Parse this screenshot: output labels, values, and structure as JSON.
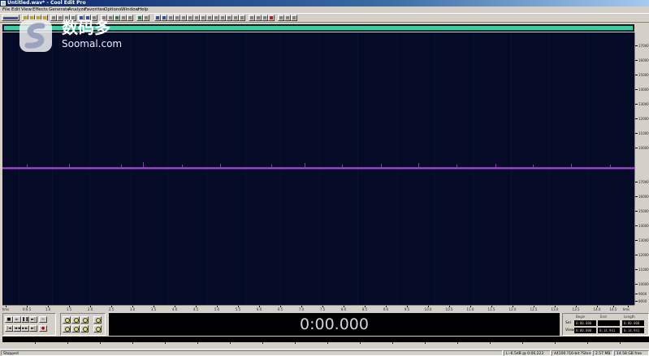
{
  "window": {
    "title": "Untitled.wav* - Cool Edit Pro"
  },
  "menu": [
    "File",
    "Edit",
    "View",
    "Effects",
    "Generate",
    "Analyze",
    "Favorites",
    "Options",
    "Window",
    "Help"
  ],
  "vruler_labels": [
    "17000",
    "16000",
    "15000",
    "14000",
    "13000",
    "12000",
    "11000",
    "10000",
    "17000",
    "16000",
    "15000",
    "14000",
    "13000",
    "12000",
    "11000",
    "10000",
    "9000",
    "8000"
  ],
  "hruler_labels": [
    "hms",
    "0:0.5",
    "1.0",
    "1.5",
    "2.0",
    "2.5",
    "3.0",
    "3.5",
    "4.0",
    "4.5",
    "5.0",
    "5.5",
    "6.0",
    "6.5",
    "7.0",
    "7.5",
    "8.0",
    "8.5",
    "9.0",
    "9.5",
    "10.0",
    "10.5",
    "11.0",
    "11.5",
    "12.0",
    "12.5",
    "13.0",
    "13.5",
    "14.0",
    "14.5",
    "hms"
  ],
  "time_display": "0:00.000",
  "selection": {
    "headers": [
      "Begin",
      "End",
      "Length"
    ],
    "sel_label": "Sel",
    "view_label": "View",
    "sel_values": [
      "0:00.000",
      "",
      "0:00.000"
    ],
    "view_values": [
      "0:00.000",
      "0:14.941",
      "0:14.941"
    ]
  },
  "status": {
    "state": "Stopped",
    "peak": "L:-6.5dB @ 0:06.223",
    "format": "44100 ?16-bit ?Stereo",
    "size": "2.57 MB",
    "free": "14.58 GB free"
  },
  "watermark": {
    "cn": "数码多",
    "en": "Soomal.com"
  },
  "colors": {
    "waveform_bg": "#050a26",
    "overview_range": "#37d0a6",
    "wave": "#7a3aa0"
  }
}
